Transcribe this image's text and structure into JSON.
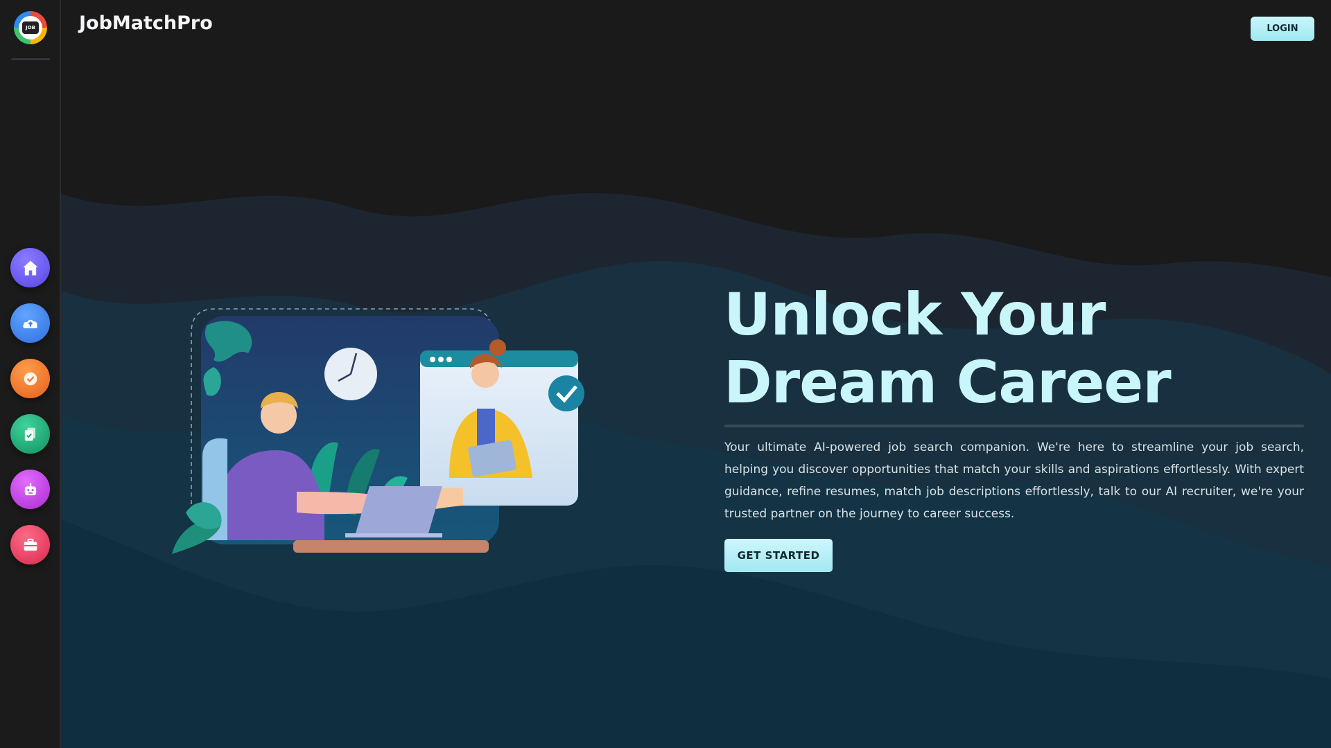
{
  "brand": {
    "name": "JobMatchPro",
    "logo_text": "JOB",
    "logo_icon": "job-logo-icon"
  },
  "header": {
    "login_label": "LOGIN"
  },
  "sidebar": {
    "items": [
      {
        "name": "home",
        "icon": "home-icon",
        "color": "#6a5cf0"
      },
      {
        "name": "upload",
        "icon": "cloud-upload-icon",
        "color": "#3f84f0"
      },
      {
        "name": "check",
        "icon": "check-badge-icon",
        "color": "#f37a2a"
      },
      {
        "name": "documents",
        "icon": "clipboard-check-icon",
        "color": "#1fae7a"
      },
      {
        "name": "ai-recruiter",
        "icon": "robot-icon",
        "color": "#c243e6"
      },
      {
        "name": "jobs",
        "icon": "briefcase-icon",
        "color": "#ee3f63"
      }
    ]
  },
  "hero": {
    "title": "Unlock Your Dream Career",
    "description": "Your ultimate AI-powered job search companion. We're here to streamline your job search, helping you discover opportunities that match your skills and aspirations effortlessly. With expert guidance, refine resumes, match job descriptions effortlessly, talk to our AI recruiter, we're your trusted partner on the journey to career success.",
    "cta_label": "GET STARTED",
    "illustration": "handshake-video-call-illustration"
  },
  "colors": {
    "background": "#1a1a1b",
    "accent": "#c9f6fb",
    "wave_dark": "#0f2a3a"
  }
}
